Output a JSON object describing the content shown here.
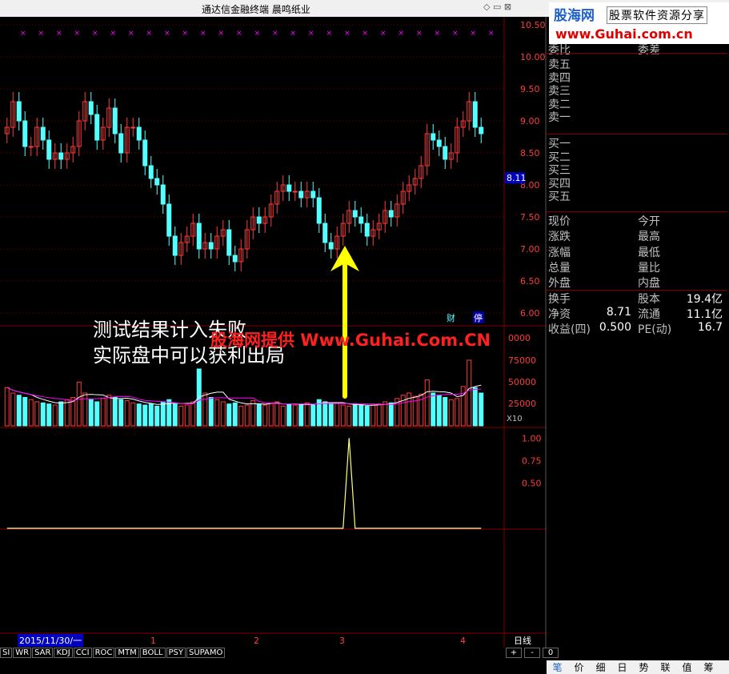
{
  "window": {
    "title": "通达信金融终端    晨鸣纸业",
    "controls": "◇ ▭ ⊠"
  },
  "logo": {
    "brand": "股海网",
    "slogan": "股票软件资源分享",
    "site": "www.Guhai.com.cn"
  },
  "annotation": {
    "line1": "测试结果计入失败",
    "line2": "实际盘中可以获利出局"
  },
  "watermark": "股海网提供 Www.Guhai.Com.CN",
  "price_axis": {
    "labels": [
      "10.50",
      "10.00",
      "9.50",
      "9.00",
      "8.50",
      "8.00",
      "7.50",
      "7.00",
      "6.50",
      "6.00"
    ],
    "current": "8.11"
  },
  "volume_axis": {
    "labels": [
      "0000",
      "75000",
      "50000",
      "25000"
    ],
    "unit": "X10"
  },
  "indicator_axis": {
    "labels": [
      "1.00",
      "0.75",
      "0.50"
    ]
  },
  "badges": {
    "cai": "财",
    "ting": "停"
  },
  "x_axis": {
    "date": "2015/11/30/一",
    "months": [
      "1",
      "2",
      "3",
      "4"
    ],
    "period": "日线"
  },
  "indicator_tabs": [
    "SI",
    "WR",
    "SAR",
    "KDJ",
    "CCI",
    "ROC",
    "MTM",
    "BOLL",
    "PSY",
    "SUPAMO"
  ],
  "scroll_buttons": [
    "+",
    "-",
    "0"
  ],
  "quote": {
    "order_book": {
      "header_left": "委比",
      "header_right": "委差",
      "sell": [
        "卖五",
        "卖四",
        "卖三",
        "卖二",
        "卖一"
      ],
      "buy": [
        "买一",
        "买二",
        "买三",
        "买四",
        "买五"
      ]
    },
    "fields": [
      {
        "l": "现价",
        "m": "今开",
        "v1": "",
        "v2": ""
      },
      {
        "l": "涨跌",
        "m": "最高",
        "v1": "",
        "v2": ""
      },
      {
        "l": "涨幅",
        "m": "最低",
        "v1": "",
        "v2": ""
      },
      {
        "l": "总量",
        "m": "量比",
        "v1": "",
        "v2": ""
      },
      {
        "l": "外盘",
        "m": "内盘",
        "v1": "",
        "v2": ""
      },
      {
        "l": "换手",
        "m": "股本",
        "v1": "",
        "v2": "19.4亿"
      },
      {
        "l": "净资",
        "m": "流通",
        "v1": "8.71",
        "v2": "11.1亿"
      },
      {
        "l": "收益(四)",
        "m": "PE(动)",
        "v1": "0.500",
        "v2": "16.7"
      }
    ]
  },
  "bottom_tabs": [
    "笔",
    "价",
    "细",
    "日",
    "势",
    "联",
    "值",
    "筹"
  ],
  "colors": {
    "up": "#ff3c3c",
    "down": "#54ffff",
    "grid": "#800000",
    "axis_text": "#ff3c3c",
    "arrow": "#ffff00",
    "ma_vol1": "#ffffff",
    "ma_vol2": "#ff00ff"
  },
  "chart_data": [
    {
      "type": "candlestick",
      "ylim": [
        5.8,
        10.6
      ],
      "close": [
        8.9,
        9.3,
        9.0,
        8.6,
        8.6,
        8.9,
        8.7,
        8.4,
        8.5,
        8.4,
        8.5,
        8.6,
        9.0,
        9.3,
        9.1,
        8.7,
        8.9,
        9.2,
        8.8,
        8.5,
        8.9,
        8.9,
        8.7,
        8.3,
        8.1,
        8.0,
        7.7,
        7.2,
        6.9,
        7.1,
        7.2,
        7.4,
        7.0,
        7.1,
        7.0,
        7.2,
        7.3,
        6.9,
        6.8,
        7.0,
        7.3,
        7.5,
        7.4,
        7.5,
        7.7,
        7.9,
        8.0,
        7.9,
        7.9,
        7.8,
        7.9,
        7.8,
        7.4,
        7.1,
        7.0,
        7.2,
        7.4,
        7.6,
        7.5,
        7.4,
        7.2,
        7.3,
        7.4,
        7.6,
        7.5,
        7.7,
        7.9,
        8.0,
        8.1,
        8.3,
        8.8,
        8.7,
        8.6,
        8.4,
        8.5,
        8.9,
        9.0,
        9.3,
        8.9,
        8.8
      ]
    },
    {
      "type": "bar",
      "name": "volume",
      "ylim": [
        0,
        90000
      ],
      "values": [
        35000,
        30000,
        28000,
        26000,
        24000,
        22000,
        21000,
        20000,
        19000,
        22000,
        24000,
        26000,
        40000,
        30000,
        24000,
        22000,
        25000,
        28000,
        26000,
        24000,
        23000,
        21000,
        20000,
        19000,
        20000,
        18000,
        22000,
        24000,
        20000,
        18000,
        19000,
        22000,
        52000,
        30000,
        26000,
        24000,
        22000,
        20000,
        21000,
        18000,
        19000,
        23000,
        20000,
        19000,
        21000,
        22000,
        18000,
        20000,
        19000,
        20000,
        21000,
        19000,
        24000,
        22000,
        20000,
        21000,
        19000,
        18000,
        20000,
        19000,
        18000,
        19000,
        20000,
        22000,
        21000,
        25000,
        28000,
        30000,
        27000,
        29000,
        42000,
        30000,
        28000,
        26000,
        24000,
        25000,
        36000,
        60000,
        35000,
        30000
      ]
    },
    {
      "type": "line",
      "name": "signal",
      "ylim": [
        0,
        1.1
      ],
      "values": [
        0,
        0,
        0,
        0,
        0,
        0,
        0,
        0,
        0,
        0,
        0,
        0,
        0,
        0,
        0,
        0,
        0,
        0,
        0,
        0,
        0,
        0,
        0,
        0,
        0,
        0,
        0,
        0,
        0,
        0,
        0,
        0,
        0,
        0,
        0,
        0,
        0,
        0,
        0,
        0,
        0,
        0,
        0,
        0,
        0,
        0,
        0,
        0,
        0,
        0,
        0,
        0,
        0,
        0,
        0,
        0,
        0,
        1,
        0,
        0,
        0,
        0,
        0,
        0,
        0,
        0,
        0,
        0,
        0,
        0,
        0,
        0,
        0,
        0,
        0,
        0,
        0,
        0,
        0,
        0
      ]
    }
  ]
}
